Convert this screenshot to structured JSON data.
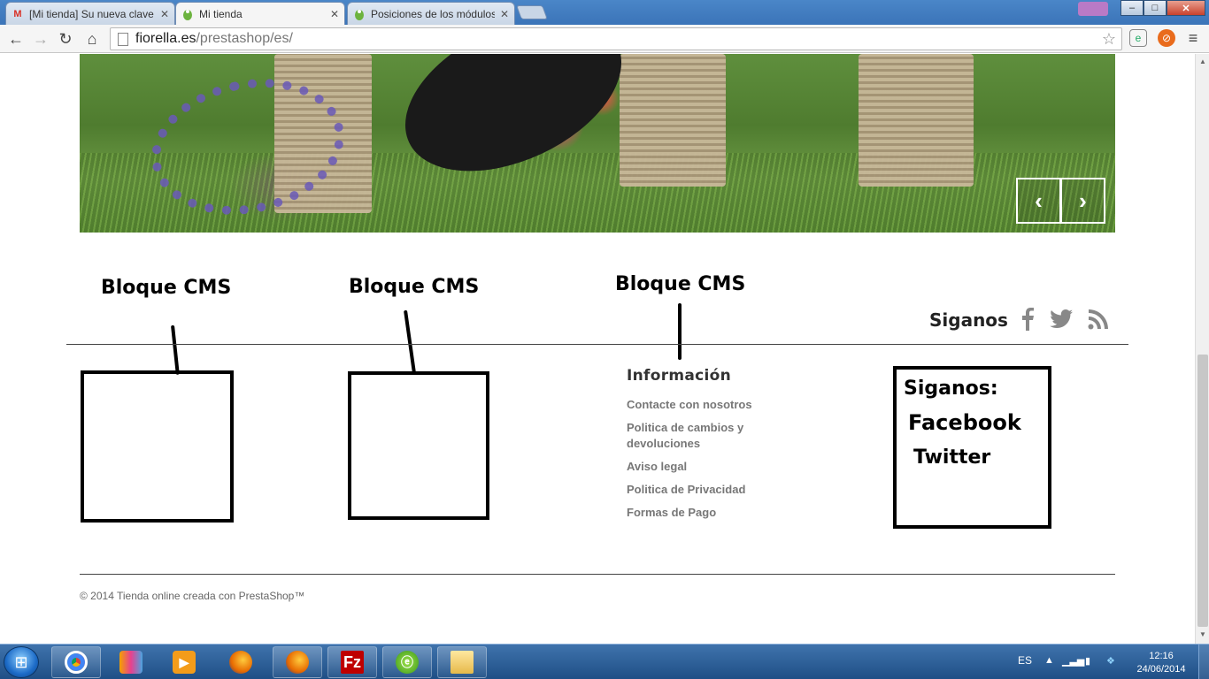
{
  "browser": {
    "tabs": [
      {
        "title": "[Mi tienda] Su nueva clave",
        "favicon": "gmail-icon"
      },
      {
        "title": "Mi tienda",
        "favicon": "prestashop-icon",
        "active": true
      },
      {
        "title": "Posiciones de los módulos",
        "favicon": "prestashop-icon"
      }
    ],
    "url_host": "fiorella.es",
    "url_path": "/prestashop/es/",
    "window_controls": {
      "minimize": "–",
      "maximize": "□",
      "close": "✕"
    }
  },
  "slider": {
    "prev_label": "‹",
    "next_label": "›"
  },
  "annotations": {
    "cms_label_1": "Bloque CMS",
    "cms_label_2": "Bloque CMS",
    "cms_label_3": "Bloque CMS",
    "social_box_title": "Siganos:",
    "social_box_facebook": "Facebook",
    "social_box_twitter": "Twitter"
  },
  "footer": {
    "follow_title": "Siganos",
    "info_title": "Información",
    "info_links": [
      "Contacte con nosotros",
      "Politica de cambios y devoluciones",
      "Aviso legal",
      "Politica de Privacidad",
      "Formas de Pago"
    ],
    "copyright": "© 2014 Tienda online creada con PrestaShop™"
  },
  "taskbar": {
    "language": "ES",
    "time": "12:16",
    "date": "24/06/2014"
  },
  "colors": {
    "tabbar_blue": "#3b74b8",
    "link_gray": "#777777",
    "taskbar_blue": "#1f4f86"
  }
}
